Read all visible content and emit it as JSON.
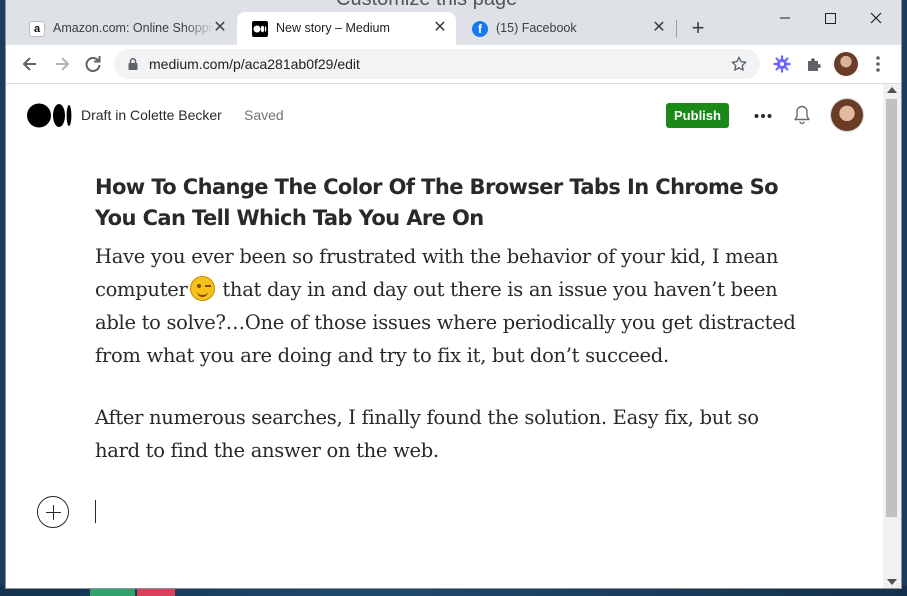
{
  "browser": {
    "tabs": [
      {
        "title": "Amazon.com: Online Shoppin",
        "active": false,
        "favicon": "amazon-logo-icon"
      },
      {
        "title": "New story – Medium",
        "active": true,
        "favicon": "medium-logo-icon"
      },
      {
        "title": "(15) Facebook",
        "active": false,
        "favicon": "facebook-logo-icon"
      }
    ],
    "new_tab_label": "+",
    "url": "medium.com/p/aca281ab0f29/edit",
    "background_window_title": "Customize this page",
    "colors": {
      "tabstrip": "#dee1e6",
      "active_tab": "#ffffff"
    }
  },
  "medium": {
    "draft_label": "Draft in Colette Becker",
    "status": "Saved",
    "publish_label": "Publish",
    "accent_color": "#1a8917"
  },
  "story": {
    "title": "How To Change The Color Of The Browser Tabs In Chrome So You Can Tell Which Tab You Are On",
    "paragraph1_part1": "Have you ever been so frustrated with the behavior of your kid, I mean computer",
    "paragraph1_part2": " that day in and day out there is an issue you haven’t been able to solve?…One of those issues where periodically you get distracted from what you are doing and try to fix it, but don’t succeed.",
    "paragraph2": "After numerous searches, I finally found the solution. Easy fix, but so hard to find the answer on the web.",
    "emoji": "winking-face"
  }
}
